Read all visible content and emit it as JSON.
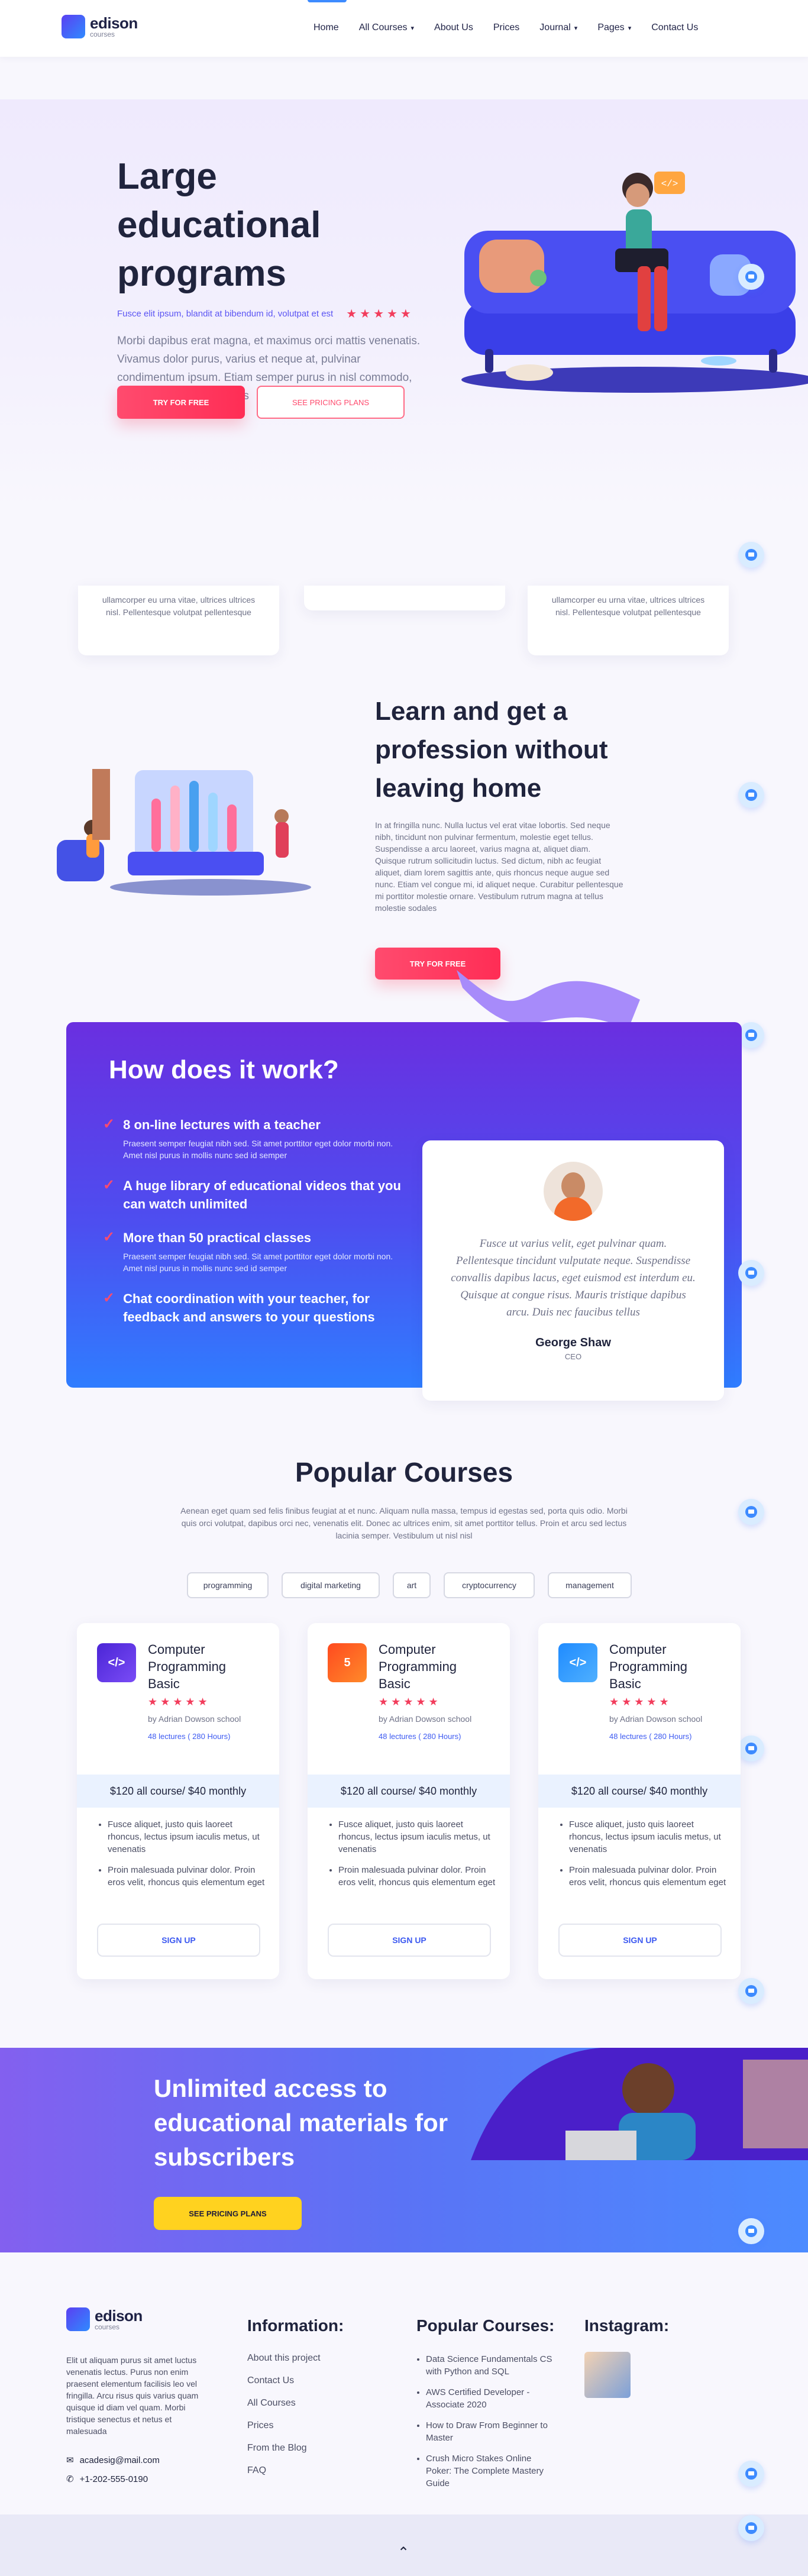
{
  "brand": {
    "name": "edison",
    "sub": "courses"
  },
  "nav": {
    "items": [
      "Home",
      "All Courses",
      "About Us",
      "Prices",
      "Journal",
      "Pages",
      "Contact Us"
    ]
  },
  "hero": {
    "title": "Large educational programs",
    "subtitle": "Fusce elit ipsum, blandit at bibendum id, volutpat et est",
    "rating": "★★★★★",
    "body": "Morbi dapibus erat magna, et maximus orci mattis venenatis. Vivamus dolor purus, varius et neque at, pulvinar condimentum ipsum. Etiam semper purus in nisl commodo, quis sodales quam sagittis",
    "btn_primary": "TRY FOR FREE",
    "btn_secondary": "SEE PRICING PLANS"
  },
  "features": {
    "left_text": "ullamcorper eu urna vitae, ultrices ultrices nisl. Pellentesque volutpat pellentesque",
    "right_text": "ullamcorper eu urna vitae, ultrices ultrices nisl. Pellentesque volutpat pellentesque"
  },
  "learn": {
    "title": "Learn and get a profession without leaving home",
    "body": "In at fringilla nunc. Nulla luctus vel erat vitae lobortis. Sed neque nibh, tincidunt non pulvinar fermentum, molestie eget tellus. Suspendisse a arcu laoreet, varius magna at, aliquet diam. Quisque rutrum sollicitudin luctus. Sed dictum, nibh ac feugiat aliquet, diam lorem sagittis ante, quis rhoncus neque augue sed nunc. Etiam vel congue mi, id aliquet neque. Curabitur pellentesque mi porttitor molestie ornare. Vestibulum rutrum magna at tellus molestie sodales",
    "btn": "TRY FOR FREE"
  },
  "how": {
    "title": "How does it work?",
    "items": [
      {
        "title": "8 on-line lectures with a teacher",
        "desc": "Praesent semper feugiat nibh sed. Sit amet porttitor eget dolor morbi non. Amet nisl purus in mollis nunc sed id semper"
      },
      {
        "title": "A huge library of educational videos that you can watch unlimited",
        "desc": ""
      },
      {
        "title": "More than 50 practical classes",
        "desc": "Praesent semper feugiat nibh sed. Sit amet porttitor eget dolor morbi non. Amet nisl purus in mollis nunc sed id semper"
      },
      {
        "title": "Chat coordination with your teacher, for feedback and answers to your questions",
        "desc": ""
      }
    ],
    "quote": "Fusce ut varius velit, eget pulvinar quam. Pellentesque tincidunt vulputate neque. Suspendisse convallis dapibus lacus, eget euismod est interdum eu. Quisque at congue risus. Mauris tristique dapibus arcu. Duis nec faucibus tellus",
    "person": "George Shaw",
    "role": "CEO"
  },
  "popular": {
    "title": "Popular Courses",
    "intro": "Aenean eget quam sed felis finibus feugiat at et nunc. Aliquam nulla massa, tempus id egestas sed, porta quis odio. Morbi quis orci volutpat, dapibus orci nec, venenatis elit. Donec ac ultrices enim, sit amet porttitor tellus. Proin et arcu sed lectus lacinia semper. Vestibulum ut nisl nisl",
    "tags": [
      "programming",
      "digital marketing",
      "art",
      "cryptocurrency",
      "management"
    ],
    "courses": [
      {
        "title": "Computer Programming Basic",
        "stars": "★★★★★",
        "by": "by Adrian Dowson school",
        "lectures": "48 lectures ( 280 Hours)",
        "price": "$120 all course/ $40 monthly",
        "b1": "Fusce aliquet, justo quis laoreet rhoncus, lectus ipsum iaculis metus, ut venenatis",
        "b2": "Proin malesuada pulvinar dolor. Proin eros velit, rhoncus quis elementum eget",
        "btn": "SIGN UP",
        "icon": "</>",
        "color": "#5a2fe0"
      },
      {
        "title": "Computer Programming Basic",
        "stars": "★★★★★",
        "by": "by Adrian Dowson school",
        "lectures": "48 lectures ( 280 Hours)",
        "price": "$120 all course/ $40 monthly",
        "b1": "Fusce aliquet, justo quis laoreet rhoncus, lectus ipsum iaculis metus, ut venenatis",
        "b2": "Proin malesuada pulvinar dolor. Proin eros velit, rhoncus quis elementum eget",
        "btn": "SIGN UP",
        "icon": "5",
        "color": "#ff5a1f"
      },
      {
        "title": "Computer Programming Basic",
        "stars": "★★★★★",
        "by": "by Adrian Dowson school",
        "lectures": "48 lectures ( 280 Hours)",
        "price": "$120 all course/ $40 monthly",
        "b1": "Fusce aliquet, justo quis laoreet rhoncus, lectus ipsum iaculis metus, ut venenatis",
        "b2": "Proin malesuada pulvinar dolor. Proin eros velit, rhoncus quis elementum eget",
        "btn": "SIGN UP",
        "icon": "</>",
        "color": "#2f7dff"
      }
    ]
  },
  "band": {
    "title": "Unlimited access to educational materials for subscribers",
    "btn": "SEE PRICING PLANS"
  },
  "footer": {
    "about": "Elit ut aliquam purus sit amet luctus venenatis lectus. Purus non enim praesent elementum facilisis leo vel fringilla. Arcu risus quis varius quam quisque id diam vel quam. Morbi tristique senectus et netus et malesuada",
    "email": "acadesig@mail.com",
    "phone": "+1-202-555-0190",
    "info_title": "Information:",
    "info": [
      "About this project",
      "Contact Us",
      "All Courses",
      "Prices",
      "From the Blog",
      "FAQ"
    ],
    "courses_title": "Popular Courses:",
    "courses": [
      "Data Science Fundamentals CS with Python and SQL",
      "AWS Certified Developer - Associate 2020",
      "How to Draw From Beginner to Master",
      "Crush Micro Stakes Online Poker: The Complete Mastery Guide"
    ],
    "instagram_title": "Instagram:"
  }
}
